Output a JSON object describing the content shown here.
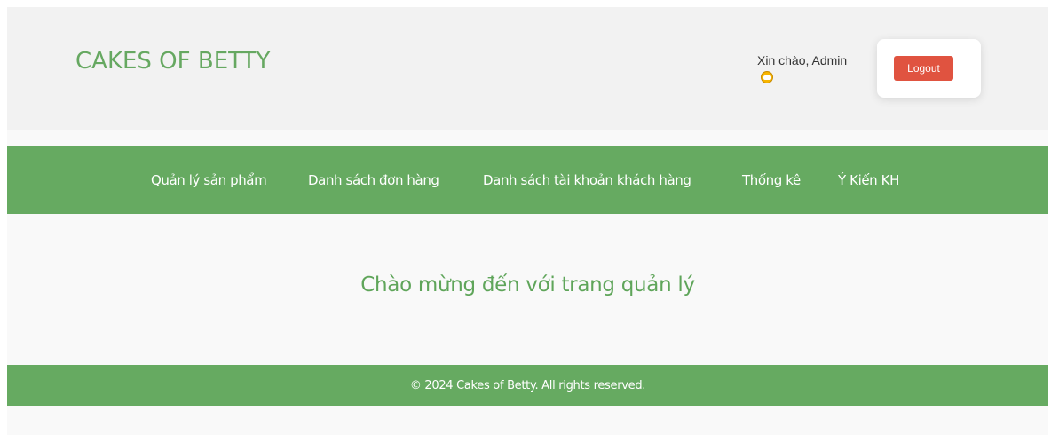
{
  "header": {
    "site_title": "CAKES OF BETTY",
    "greeting": "Xin chào, Admin",
    "greeting_icon": "smiling-face-icon",
    "logout_label": "Logout"
  },
  "nav": {
    "items": [
      {
        "label": "Quản lý sản phẩm"
      },
      {
        "label": "Danh sách đơn hàng"
      },
      {
        "label": "Danh sách tài khoản khách hàng"
      },
      {
        "label": "Thống kê"
      },
      {
        "label": "Ý Kiến KH"
      }
    ]
  },
  "main": {
    "welcome": "Chào mừng đến với trang quản lý"
  },
  "footer": {
    "text": "© 2024 Cakes of Betty. All rights reserved."
  },
  "colors": {
    "brand_green": "#66aa61",
    "logout_red": "#e05340",
    "header_bg": "#f2f2f2"
  }
}
